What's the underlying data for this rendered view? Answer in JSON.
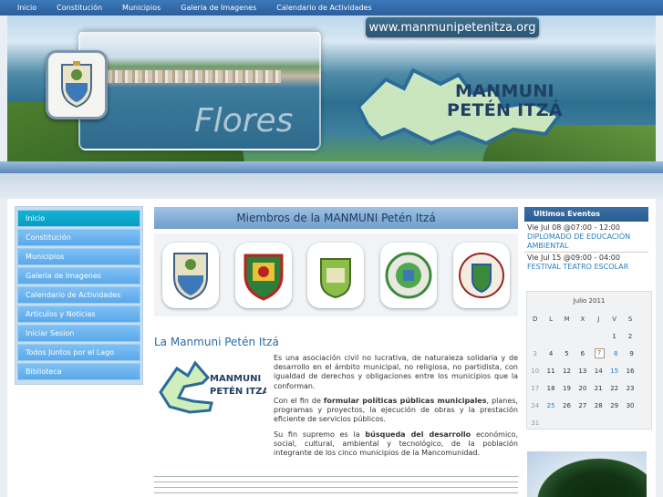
{
  "topnav": [
    "Inicio",
    "Constitución",
    "Municipios",
    "Galeria de Imagenes",
    "Calendario de Actividades"
  ],
  "banner": {
    "url": "www.manmunipetenitza.org",
    "brand_line1": "MANMUNI",
    "brand_line2": "PETÉN ITZÁ",
    "place": "Flores"
  },
  "sidebar": [
    "Inicio",
    "Constitución",
    "Municipios",
    "Galeria de Imagenes",
    "Calendario de Actividades",
    "Articulos y Noticias",
    "Iniciar Sesion",
    "Todos Juntos por el Lago",
    "Biblioteca"
  ],
  "main": {
    "members_title": "Miembros de la MANMUNI Petén Itzá",
    "section_title": "La Manmuni Petén Itzá",
    "minimap_line1": "MANMUNI",
    "minimap_line2": "PETÉN ITZA",
    "p1": "Es una asociación civil no lucrativa, de naturaleza solidaria y de desarrollo en el ámbito municipal, no religiosa, no partidista, con igualdad de derechos y obligaciones entre los municipios que la conforman.",
    "p2_pre": "Con el fin de ",
    "p2_bold": "formular políticas públicas municipales",
    "p2_post": ", planes, programas y proyectos, la ejecución de obras y la prestación eficiente de servicios públicos.",
    "p3_pre": "Su fin supremo es la ",
    "p3_bold": "búsqueda del desarrollo",
    "p3_post": " económico, social, cultural, ambiental y tecnológico, de la población integrante de los cinco municipios de la Mancomunidad."
  },
  "events": {
    "title": "Ultimos Eventos",
    "items": [
      {
        "date": "Vie Jul 08 @07:00 - 12:00",
        "title": "DIPLOMADO DE EDUCACIÓN AMBIENTAL"
      },
      {
        "date": "Vie Jul 15 @09:00 - 04:00",
        "title": "FESTIVAL TEATRO ESCOLAR"
      }
    ]
  },
  "calendar": {
    "month": "Julio 2011",
    "headers": [
      "D",
      "L",
      "M",
      "X",
      "J",
      "V",
      "S"
    ],
    "weeks": [
      [
        "",
        "",
        "",
        "",
        "",
        "1",
        "2"
      ],
      [
        "3",
        "4",
        "5",
        "6",
        "7",
        "8",
        "9"
      ],
      [
        "10",
        "11",
        "12",
        "13",
        "14",
        "15",
        "16"
      ],
      [
        "17",
        "18",
        "19",
        "20",
        "21",
        "22",
        "23"
      ],
      [
        "24",
        "25",
        "26",
        "27",
        "28",
        "29",
        "30"
      ],
      [
        "31",
        "",
        "",
        "",
        "",
        "",
        ""
      ]
    ],
    "colors": {
      "event_day": "#1f7fd0",
      "today": "#b07000"
    }
  },
  "colors": {
    "accent": "#2a6aa8",
    "nav": "#2b5f9c",
    "menu": "#5aa8ea",
    "active_menu": "#0a9cc0"
  }
}
